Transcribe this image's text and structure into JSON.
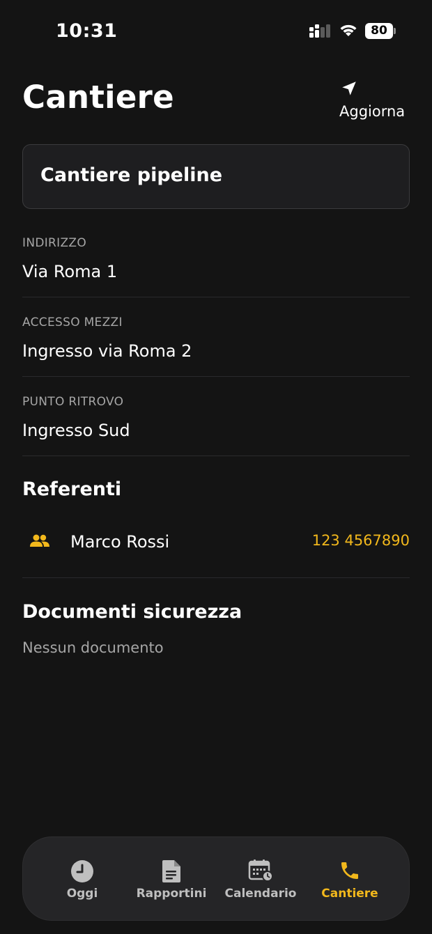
{
  "status_bar": {
    "time": "10:31",
    "battery": "80"
  },
  "header": {
    "title": "Cantiere",
    "refresh_label": "Aggiorna",
    "refresh_icon": "location-arrow-icon"
  },
  "site": {
    "name": "Cantiere pipeline"
  },
  "details": [
    {
      "label": "INDIRIZZO",
      "value": "Via Roma 1"
    },
    {
      "label": "ACCESSO MEZZI",
      "value": "Ingresso via Roma 2"
    },
    {
      "label": "PUNTO RITROVO",
      "value": "Ingresso Sud"
    }
  ],
  "contacts": {
    "title": "Referenti",
    "items": [
      {
        "name": "Marco Rossi",
        "phone": "123 4567890",
        "icon": "people-icon"
      }
    ]
  },
  "documents": {
    "title": "Documenti sicurezza",
    "empty_text": "Nessun documento"
  },
  "nav": {
    "items": [
      {
        "label": "Oggi",
        "icon": "clock-icon",
        "active": false
      },
      {
        "label": "Rapportini",
        "icon": "document-icon",
        "active": false
      },
      {
        "label": "Calendario",
        "icon": "calendar-icon",
        "active": false
      },
      {
        "label": "Cantiere",
        "icon": "phone-icon",
        "active": true
      }
    ]
  },
  "colors": {
    "background": "#141414",
    "accent": "#f2b81c",
    "card": "#1e1e20",
    "muted_text": "#a6a6a6"
  }
}
